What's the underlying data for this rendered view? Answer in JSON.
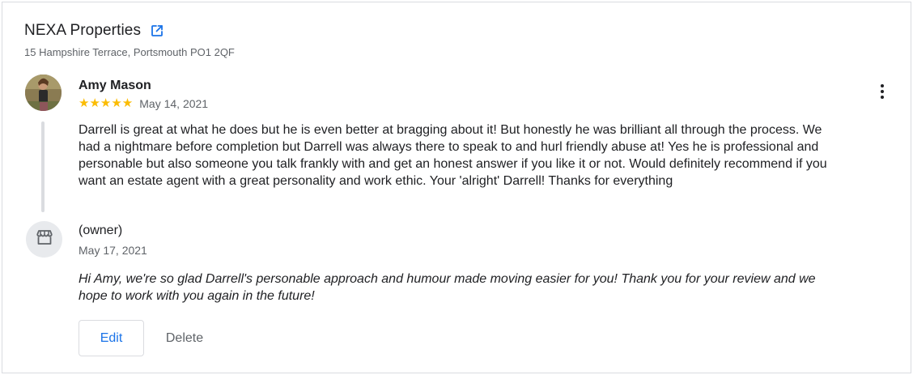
{
  "business": {
    "name": "NEXA Properties",
    "address": "15 Hampshire Terrace, Portsmouth PO1 2QF",
    "open_icon": "open-in-new-icon"
  },
  "review": {
    "reviewer_name": "Amy Mason",
    "stars": "★★★★★",
    "rating": 5,
    "date": "May 14, 2021",
    "text": "Darrell is great at what he does but he is even better at bragging about it! But honestly he was brilliant all through the process. We had a nightmare before completion but Darrell was always there to speak to and hurl friendly abuse at! Yes he is professional and personable but also someone you talk frankly with and get an honest answer if you like it or not. Would definitely recommend if you want an estate agent with a great personality and work ethic. Your 'alright' Darrell! Thanks for everything",
    "more_icon": "more-vert-icon"
  },
  "owner_response": {
    "label": "(owner)",
    "date": "May 17, 2021",
    "text": "Hi Amy, we're so glad Darrell's personable approach and humour made moving easier for you! Thank you for your review and we hope to work with you again in the future!",
    "icon": "storefront-icon"
  },
  "actions": {
    "edit_label": "Edit",
    "delete_label": "Delete"
  },
  "colors": {
    "accent": "#1a73e8",
    "star": "#fbbc04",
    "secondary_text": "#5f6368",
    "border": "#dadce0"
  }
}
